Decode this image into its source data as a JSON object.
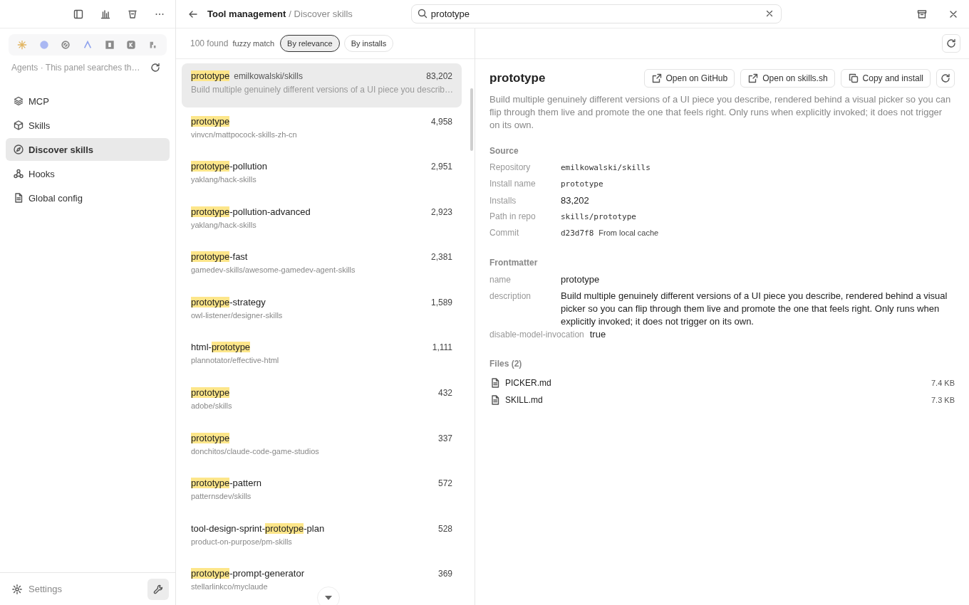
{
  "sidebar": {
    "agent_note": "Agents · This panel searches th…",
    "items": [
      {
        "label": "MCP",
        "selected": false
      },
      {
        "label": "Skills",
        "selected": false
      },
      {
        "label": "Discover skills",
        "selected": true
      },
      {
        "label": "Hooks",
        "selected": false
      },
      {
        "label": "Global config",
        "selected": false
      }
    ],
    "settings": "Settings"
  },
  "header": {
    "title": "Tool management",
    "crumb": "/ Discover skills",
    "search": {
      "value": "prototype"
    }
  },
  "toolbar": {
    "count": "100 found",
    "mode": "fuzzy match",
    "sorts": [
      {
        "label": "By relevance",
        "selected": true
      },
      {
        "label": "By installs",
        "selected": false
      }
    ]
  },
  "results": [
    {
      "parts": [
        {
          "text": "prototype",
          "highlight": true
        }
      ],
      "repo": "emilkowalski/skills",
      "installs": "83,202",
      "description": "Build multiple genuinely different versions of a UI piece you describ…",
      "selected": true
    },
    {
      "parts": [
        {
          "text": "prototype",
          "highlight": true
        }
      ],
      "repo": "vinvcn/mattpocock-skills-zh-cn",
      "installs": "4,958",
      "selected": false
    },
    {
      "parts": [
        {
          "text": "prototype",
          "highlight": true
        },
        {
          "text": "-pollution",
          "highlight": false
        }
      ],
      "repo": "yaklang/hack-skills",
      "installs": "2,951",
      "selected": false
    },
    {
      "parts": [
        {
          "text": "prototype",
          "highlight": true
        },
        {
          "text": "-pollution-advanced",
          "highlight": false
        }
      ],
      "repo": "yaklang/hack-skills",
      "installs": "2,923",
      "selected": false
    },
    {
      "parts": [
        {
          "text": "prototype",
          "highlight": true
        },
        {
          "text": "-fast",
          "highlight": false
        }
      ],
      "repo": "gamedev-skills/awesome-gamedev-agent-skills",
      "installs": "2,381",
      "selected": false
    },
    {
      "parts": [
        {
          "text": "prototype",
          "highlight": true
        },
        {
          "text": "-strategy",
          "highlight": false
        }
      ],
      "repo": "owl-listener/designer-skills",
      "installs": "1,589",
      "selected": false
    },
    {
      "parts": [
        {
          "text": "html-",
          "highlight": false
        },
        {
          "text": "prototype",
          "highlight": true
        }
      ],
      "repo": "plannotator/effective-html",
      "installs": "1,111",
      "selected": false
    },
    {
      "parts": [
        {
          "text": "prototype",
          "highlight": true
        }
      ],
      "repo": "adobe/skills",
      "installs": "432",
      "selected": false
    },
    {
      "parts": [
        {
          "text": "prototype",
          "highlight": true
        }
      ],
      "repo": "donchitos/claude-code-game-studios",
      "installs": "337",
      "selected": false
    },
    {
      "parts": [
        {
          "text": "prototype",
          "highlight": true
        },
        {
          "text": "-pattern",
          "highlight": false
        }
      ],
      "repo": "patternsdev/skills",
      "installs": "572",
      "selected": false
    },
    {
      "parts": [
        {
          "text": "tool-design-sprint-",
          "highlight": false
        },
        {
          "text": "prototype",
          "highlight": true
        },
        {
          "text": "-plan",
          "highlight": false
        }
      ],
      "repo": "product-on-purpose/pm-skills",
      "installs": "528",
      "selected": false
    },
    {
      "parts": [
        {
          "text": "prototype",
          "highlight": true
        },
        {
          "text": "-prompt-generator",
          "highlight": false
        }
      ],
      "repo": "stellarlinkco/myclaude",
      "installs": "369",
      "selected": false
    }
  ],
  "detail": {
    "title": "prototype",
    "actions": [
      {
        "label": "Open on GitHub",
        "kind": "external"
      },
      {
        "label": "Open on skills.sh",
        "kind": "external"
      },
      {
        "label": "Copy and install",
        "kind": "copy"
      }
    ],
    "description": "Build multiple genuinely different versions of a UI piece you describe, rendered behind a visual picker so you can flip through them live and promote the one that feels right. Only runs when explicitly invoked; it does not trigger on its own.",
    "source": {
      "heading": "Source",
      "rows": [
        {
          "label": "Repository",
          "value": "emilkowalski/skills",
          "kind": "mono"
        },
        {
          "label": "Install name",
          "value": "prototype",
          "kind": "mono"
        },
        {
          "label": "Installs",
          "value": "83,202",
          "kind": "plain"
        },
        {
          "label": "Path in repo",
          "value": "skills/prototype",
          "kind": "mono"
        },
        {
          "label": "Commit",
          "value": "d23d7f8",
          "note": "From local cache",
          "kind": "mono"
        }
      ]
    },
    "frontmatter": {
      "heading": "Frontmatter",
      "rows": [
        {
          "label": "name",
          "value": "prototype"
        },
        {
          "label": "description",
          "value": "Build multiple genuinely different versions of a UI piece you describe, rendered behind a visual picker so you can flip through them live and promote the one that feels right. Only runs when explicitly invoked; it does not trigger on its own."
        },
        {
          "label": "disable-model-invocation",
          "value": "true"
        }
      ]
    },
    "files": {
      "heading": "Files (2)",
      "items": [
        {
          "name": "PICKER.md",
          "size": "7.4 KB"
        },
        {
          "name": "SKILL.md",
          "size": "7.3 KB"
        }
      ]
    }
  }
}
